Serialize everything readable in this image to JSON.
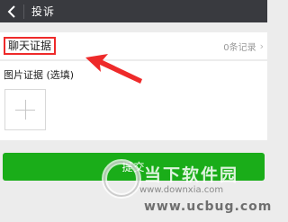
{
  "header": {
    "back_icon": "chevron-left-icon",
    "title": "投诉"
  },
  "chat_evidence": {
    "label": "聊天证据",
    "count_text": "0条记录",
    "chevron": "›",
    "highlight_color": "#ee2a2a"
  },
  "image_evidence": {
    "label": "图片证据 (选填)",
    "add_icon": "plus-icon"
  },
  "submit": {
    "label": "提交",
    "color": "#1aad19"
  },
  "watermark": {
    "main": "当下软件园",
    "url1": "www.downxia.com",
    "url2": "www.ucbug.com"
  }
}
